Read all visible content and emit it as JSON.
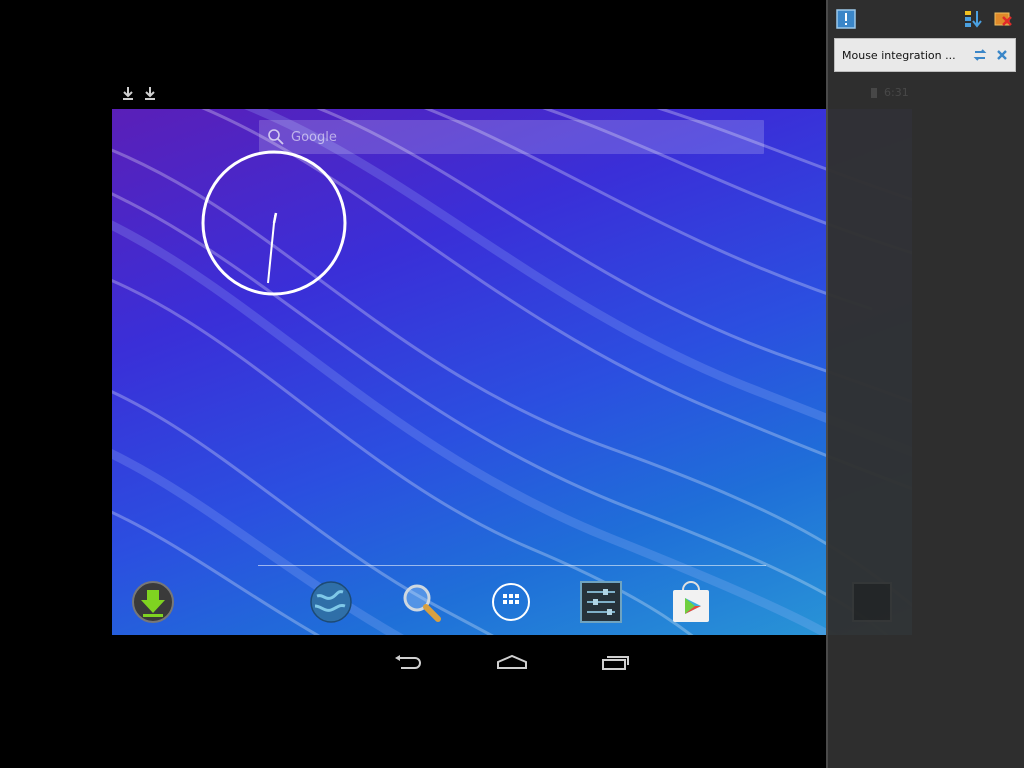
{
  "launcher": {
    "search_hint": "Google",
    "apps": [
      {
        "name": "Downloads",
        "icon": "download-icon"
      },
      {
        "name": "Browser",
        "icon": "globe-icon"
      },
      {
        "name": "Search",
        "icon": "magnifier-icon"
      },
      {
        "name": "All Apps",
        "icon": "app-drawer-icon"
      },
      {
        "name": "Settings",
        "icon": "settings-sliders-icon"
      },
      {
        "name": "Play Store",
        "icon": "play-store-icon"
      }
    ]
  },
  "side_panel": {
    "notification_text": "Mouse integration ...",
    "ghost_time": "6:31"
  },
  "colors": {
    "wallpaper_start": "#5a1fb8",
    "wallpaper_end": "#2a9ad6",
    "panel_bg": "#303030"
  }
}
